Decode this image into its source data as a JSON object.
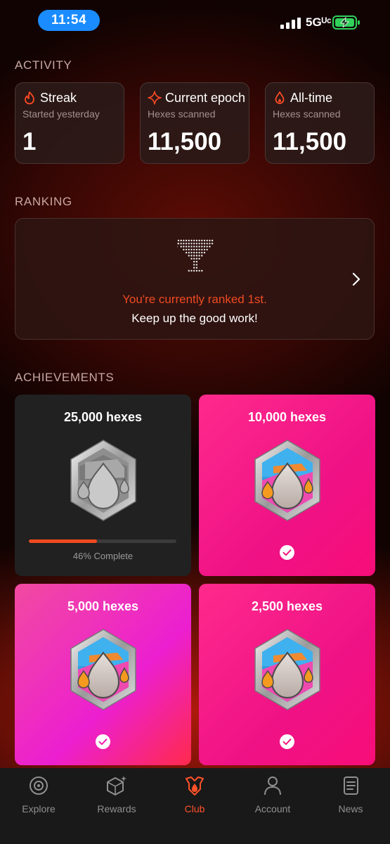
{
  "status_bar": {
    "time": "11:54",
    "network": "5Gᵁᶜ"
  },
  "activity": {
    "section_title": "ACTIVITY",
    "cards": [
      {
        "icon": "flame-outline-icon",
        "title": "Streak",
        "subtitle": "Started yesterday",
        "value": "1"
      },
      {
        "icon": "sparkle-star-icon",
        "title": "Current epoch",
        "subtitle": "Hexes scanned",
        "value": "11,500"
      },
      {
        "icon": "flame-drop-icon",
        "title": "All-time",
        "subtitle": "Hexes scanned",
        "value": "11,500"
      }
    ]
  },
  "ranking": {
    "section_title": "RANKING",
    "rank_text": "You're currently ranked 1st.",
    "sub_text": "Keep up the good work!"
  },
  "achievements": {
    "section_title": "ACHIEVEMENTS",
    "items": [
      {
        "title": "25,000 hexes",
        "completed": false,
        "progress_percent": 46,
        "progress_label": "46% Complete"
      },
      {
        "title": "10,000 hexes",
        "completed": true
      },
      {
        "title": "5,000 hexes",
        "completed": true
      },
      {
        "title": "2,500 hexes",
        "completed": true
      }
    ]
  },
  "nav": {
    "items": [
      {
        "label": "Explore",
        "icon": "compass-target-icon",
        "active": false
      },
      {
        "label": "Rewards",
        "icon": "gem-sparkle-icon",
        "active": false
      },
      {
        "label": "Club",
        "icon": "club-crest-icon",
        "active": true
      },
      {
        "label": "Account",
        "icon": "person-icon",
        "active": false
      },
      {
        "label": "News",
        "icon": "document-lines-icon",
        "active": false
      }
    ]
  },
  "colors": {
    "accent": "#ee4a22",
    "card_pink": "#f2177c",
    "locked_card": "#212121",
    "status_pill": "#1a8cff"
  }
}
